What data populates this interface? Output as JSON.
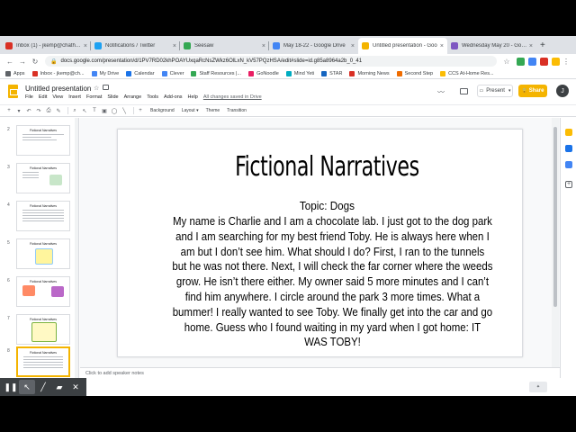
{
  "browser": {
    "tabs": [
      {
        "title": "Inbox (1) - jkemp@chatham",
        "color": "#d93025",
        "active": false
      },
      {
        "title": "Notifications / Twitter",
        "color": "#1da1f2",
        "active": false
      },
      {
        "title": "Seesaw",
        "color": "#34a853",
        "active": false
      },
      {
        "title": "May 18-22 - Google Drive",
        "color": "#4285f4",
        "active": false
      },
      {
        "title": "Untitled presentation - Goo",
        "color": "#f4b400",
        "active": true
      },
      {
        "title": "Wednesday May 20 - Goog",
        "color": "#7e57c2",
        "active": false
      }
    ],
    "url": "docs.google.com/presentation/d/1PV7RD02khPOAYUxqaRcNsZWkz6OlLxN_kV57PQzHSA/edit#slide=id.g85a8964a2b_0_41",
    "bookmarks": [
      {
        "label": "Apps",
        "color": "#5f6368"
      },
      {
        "label": "Inbox - jkemp@ch...",
        "color": "#d93025"
      },
      {
        "label": "My Drive",
        "color": "#4285f4"
      },
      {
        "label": "Calendar",
        "color": "#1a73e8"
      },
      {
        "label": "Clever",
        "color": "#4285f4"
      },
      {
        "label": "Staff Resources |...",
        "color": "#34a853"
      },
      {
        "label": "GoNoodle",
        "color": "#e91e63"
      },
      {
        "label": "Mind Yeti",
        "color": "#00acc1"
      },
      {
        "label": "STAR",
        "color": "#1565c0"
      },
      {
        "label": "Morning News",
        "color": "#d93025"
      },
      {
        "label": "Second Step",
        "color": "#ef6c00"
      },
      {
        "label": "CCS At-Home Res...",
        "color": "#fbbc04"
      }
    ]
  },
  "app": {
    "doc_title": "Untitled presentation",
    "menus": [
      "File",
      "Edit",
      "View",
      "Insert",
      "Format",
      "Slide",
      "Arrange",
      "Tools",
      "Add-ons",
      "Help"
    ],
    "saved_status": "All changes saved in Drive",
    "present_label": "Present",
    "share_label": "Share",
    "avatar_initial": "J"
  },
  "toolbar": {
    "background_label": "Background",
    "layout_label": "Layout",
    "theme_label": "Theme",
    "transition_label": "Transition"
  },
  "filmstrip": {
    "slides": [
      {
        "number": "2",
        "title": "Fictional Narratives"
      },
      {
        "number": "3",
        "title": "Fictional Narratives"
      },
      {
        "number": "4",
        "title": "Fictional Narratives"
      },
      {
        "number": "5",
        "title": "Fictional Narratives"
      },
      {
        "number": "6",
        "title": "Fictional Narratives"
      },
      {
        "number": "7",
        "title": "Fictional Narratives"
      },
      {
        "number": "8",
        "title": "Fictional Narratives"
      }
    ]
  },
  "slide": {
    "title": "Fictional Narratives",
    "topic": "Topic: Dogs",
    "body": "My name is Charlie and I am a chocolate lab.  I just got to the dog park and I am searching for my best friend Toby.  He is always here when I am but I don’t see him.  What should I do? First, I ran to the tunnels but he was not there. Next, I will check the far corner where the weeds grow.  He isn’t there either.  My owner said 5 more minutes and I can’t find him anywhere.  I circle around the park 3 more times.  What a bummer! I really wanted to see Toby. We finally get into the car and go home.  Guess who I found waiting in my yard when I got home: IT WAS TOBY!"
  },
  "notes_placeholder": "Click to add speaker notes"
}
